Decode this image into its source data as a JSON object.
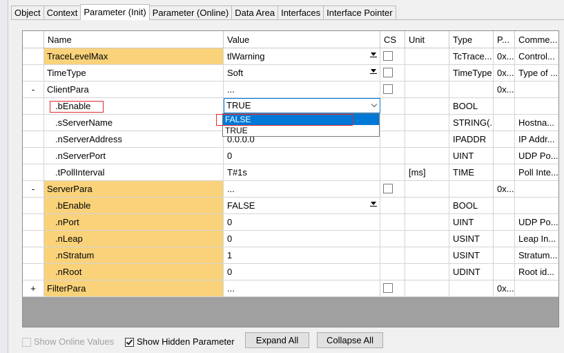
{
  "tabs": [
    "Object",
    "Context",
    "Parameter (Init)",
    "Parameter (Online)",
    "Data Area",
    "Interfaces",
    "Interface Pointer"
  ],
  "active_tab": "Parameter (Init)",
  "columns": {
    "name": "Name",
    "value": "Value",
    "cs": "CS",
    "unit": "Unit",
    "type": "Type",
    "p": "P...",
    "comment": "Comme..."
  },
  "rows": [
    {
      "expander": "",
      "name": "TraceLevelMax",
      "value": "tlWarning",
      "unit": "",
      "type": "TcTrace...",
      "p": "0x...",
      "comment": "Control..."
    },
    {
      "expander": "",
      "name": "TimeType",
      "value": "Soft",
      "unit": "",
      "type": "TimeType",
      "p": "0x...",
      "comment": "Type of ..."
    },
    {
      "expander": "-",
      "name": "ClientPara",
      "value": "...",
      "unit": "",
      "type": "",
      "p": "0x...",
      "comment": ""
    },
    {
      "expander": "",
      "name": ".bEnable",
      "value": "TRUE",
      "unit": "",
      "type": "BOOL",
      "p": "",
      "comment": ""
    },
    {
      "expander": "",
      "name": ".sServerName",
      "value": "",
      "unit": "",
      "type": "STRING(...",
      "p": "",
      "comment": "Hostna..."
    },
    {
      "expander": "",
      "name": ".nServerAddress",
      "value": "0.0.0.0",
      "unit": "",
      "type": "IPADDR",
      "p": "",
      "comment": "IP Addr..."
    },
    {
      "expander": "",
      "name": ".nServerPort",
      "value": "0",
      "unit": "",
      "type": "UINT",
      "p": "",
      "comment": "UDP Po..."
    },
    {
      "expander": "",
      "name": ".tPollInterval",
      "value": "T#1s",
      "unit": "[ms]",
      "type": "TIME",
      "p": "",
      "comment": "Poll Inte..."
    },
    {
      "expander": "-",
      "name": "ServerPara",
      "value": "...",
      "unit": "",
      "type": "",
      "p": "0x...",
      "comment": ""
    },
    {
      "expander": "",
      "name": ".bEnable",
      "value": "FALSE",
      "unit": "",
      "type": "BOOL",
      "p": "",
      "comment": ""
    },
    {
      "expander": "",
      "name": ".nPort",
      "value": "0",
      "unit": "",
      "type": "UINT",
      "p": "",
      "comment": "UDP Po..."
    },
    {
      "expander": "",
      "name": ".nLeap",
      "value": "0",
      "unit": "",
      "type": "USINT",
      "p": "",
      "comment": "Leap In..."
    },
    {
      "expander": "",
      "name": ".nStratum",
      "value": "1",
      "unit": "",
      "type": "USINT",
      "p": "",
      "comment": "Stratum..."
    },
    {
      "expander": "",
      "name": ".nRoot",
      "value": "0",
      "unit": "",
      "type": "UDINT",
      "p": "",
      "comment": "Root id..."
    },
    {
      "expander": "+",
      "name": "FilterPara",
      "value": "...",
      "unit": "",
      "type": "",
      "p": "0x...",
      "comment": ""
    }
  ],
  "dropdown_options": [
    "FALSE",
    "TRUE"
  ],
  "bottom": {
    "show_online_values": "Show Online Values",
    "show_hidden_parameter": "Show Hidden Parameter",
    "expand_all": "Expand All",
    "collapse_all": "Collapse All"
  },
  "colors": {
    "highlight": "#f9d27a",
    "selection": "#0078d7",
    "annotation": "#e0282e"
  }
}
